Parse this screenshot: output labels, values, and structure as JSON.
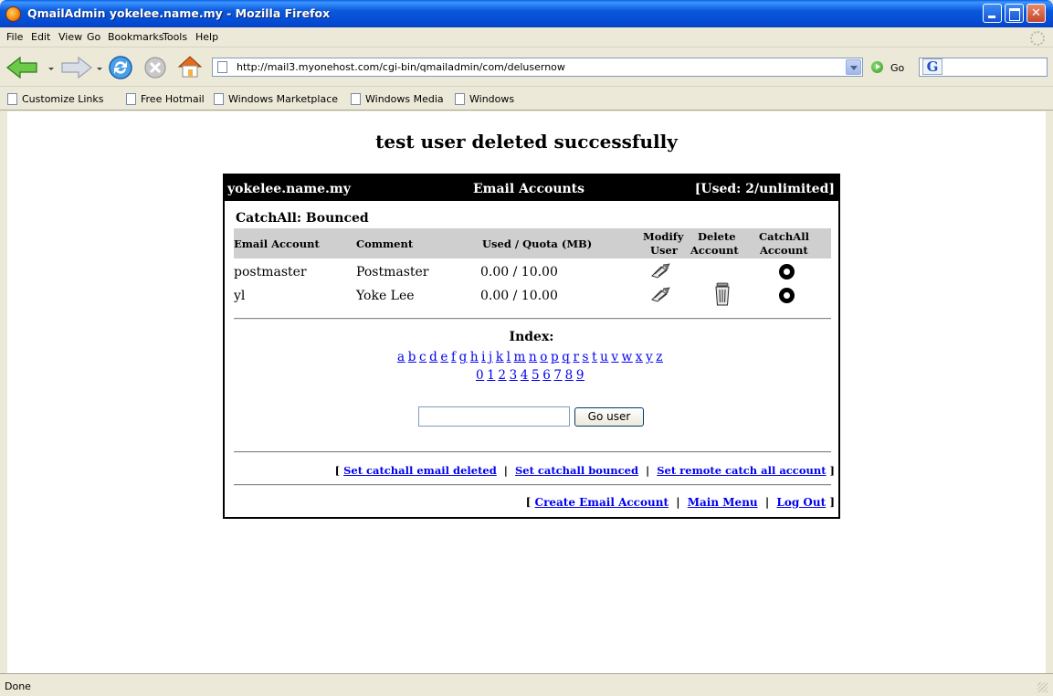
{
  "window": {
    "title": "QmailAdmin yokelee.name.my - Mozilla Firefox"
  },
  "menu": {
    "items": [
      "File",
      "Edit",
      "View",
      "Go",
      "Bookmarks",
      "Tools",
      "Help"
    ]
  },
  "nav": {
    "url": "http://mail3.myonehost.com/cgi-bin/qmailadmin/com/delusernow",
    "go_label": "Go"
  },
  "bookmarks": {
    "items": [
      "Customize Links",
      "Free Hotmail",
      "Windows Marketplace",
      "Windows Media",
      "Windows"
    ]
  },
  "page": {
    "message": "test user deleted successfully",
    "header": {
      "domain": "yokelee.name.my",
      "title": "Email Accounts",
      "used": "[Used: 2/unlimited]"
    },
    "catchall": "CatchAll: Bounced",
    "columns": {
      "account": "Email Account",
      "comment": "Comment",
      "quota": "Used / Quota (MB)",
      "modify_line1": "Modify",
      "modify_line2": "User",
      "delete_line1": "Delete",
      "delete_line2": "Account",
      "catchall_line1": "CatchAll",
      "catchall_line2": "Account"
    },
    "accounts": [
      {
        "account": "postmaster",
        "comment": "Postmaster",
        "quota": "0.00 / 10.00"
      },
      {
        "account": "yl",
        "comment": "Yoke Lee",
        "quota": "0.00 / 10.00"
      }
    ],
    "index_title": "Index:",
    "letters": [
      "a",
      "b",
      "c",
      "d",
      "e",
      "f",
      "g",
      "h",
      "i",
      "j",
      "k",
      "l",
      "m",
      "n",
      "o",
      "p",
      "q",
      "r",
      "s",
      "t",
      "u",
      "v",
      "w",
      "x",
      "y",
      "z"
    ],
    "digits": [
      "0",
      "1",
      "2",
      "3",
      "4",
      "5",
      "6",
      "7",
      "8",
      "9"
    ],
    "go_user_label": "Go user",
    "catchall_links": {
      "open": "[",
      "deleted": "Set catchall email deleted",
      "bounced": "Set catchall bounced",
      "remote": "Set remote catch all account",
      "close": "]",
      "sep": "|"
    },
    "footer_links": {
      "open": "[",
      "create": "Create Email Account",
      "main_menu": "Main Menu",
      "logout": "Log Out",
      "close": "]",
      "sep": "|"
    }
  },
  "status": {
    "text": "Done"
  }
}
